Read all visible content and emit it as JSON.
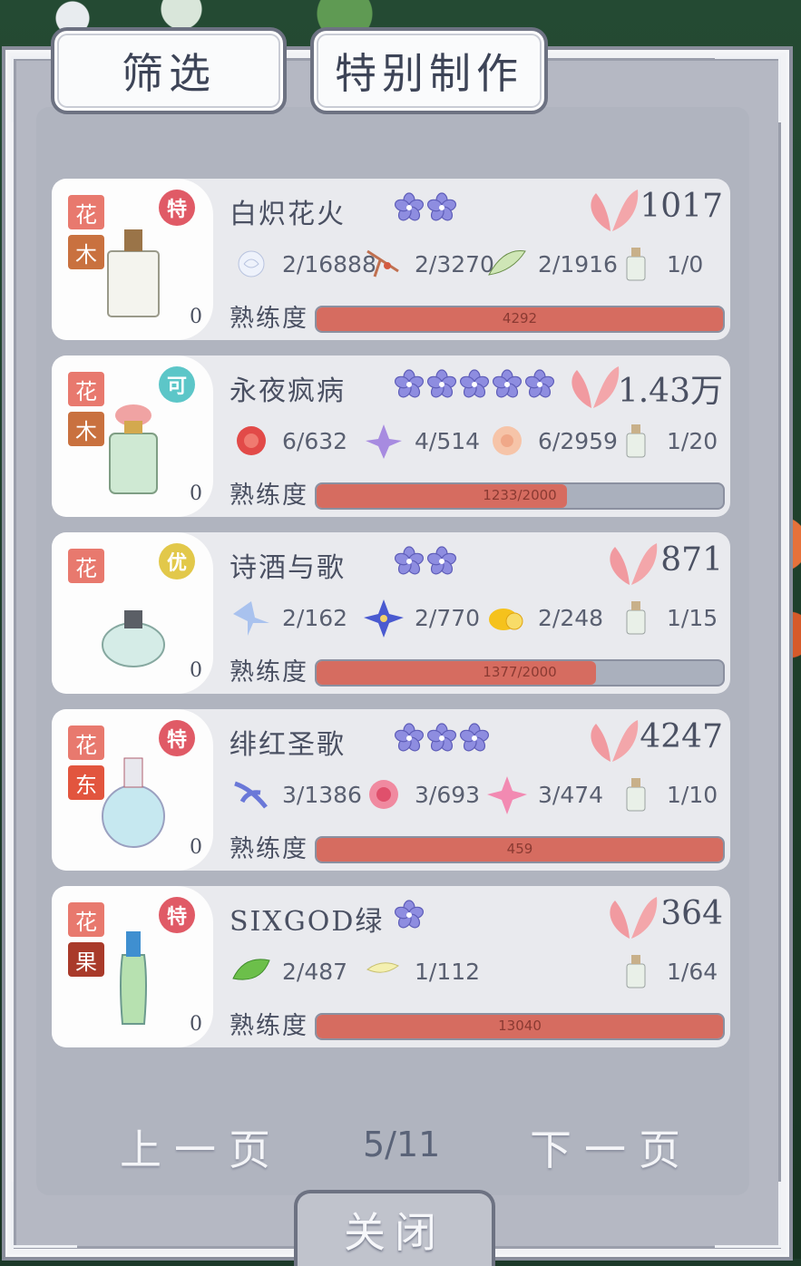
{
  "tabs": {
    "filter": "筛选",
    "special": "特别制作"
  },
  "proficiency_label": "熟练度",
  "colors": {
    "accent": "#d66c60",
    "tag_wood": "#c9713f",
    "tag_east": "#e2553e",
    "tag_fruit": "#a93a2a"
  },
  "recipes": [
    {
      "name": "白炽花火",
      "tag1": "花",
      "tag2": "木",
      "badge": "特",
      "badge_color": "#e05a66",
      "stars": 2,
      "score": "1017",
      "count": "0",
      "materials": [
        {
          "icon": "white-rose-icon",
          "value": "2/16888"
        },
        {
          "icon": "dried-twig-icon",
          "value": "2/3270"
        },
        {
          "icon": "green-leaf-icon",
          "value": "2/1916"
        },
        {
          "icon": "perfume-bottle-icon",
          "value": "1/0"
        }
      ],
      "bar_text": "4292",
      "progress": 1.0
    },
    {
      "name": "永夜疯病",
      "tag1": "花",
      "tag2": "木",
      "badge": "可",
      "badge_color": "#5cc6c8",
      "stars": 5,
      "score": "1.43万",
      "count": "0",
      "materials": [
        {
          "icon": "red-carnation-icon",
          "value": "6/632"
        },
        {
          "icon": "purple-lily-icon",
          "value": "4/514"
        },
        {
          "icon": "peach-rose-icon",
          "value": "6/2959"
        },
        {
          "icon": "perfume-bottle-icon",
          "value": "1/20"
        }
      ],
      "bar_text": "1233/2000",
      "progress": 0.6165
    },
    {
      "name": "诗酒与歌",
      "tag1": "花",
      "tag2": "",
      "badge": "优",
      "badge_color": "#e2c84a",
      "stars": 2,
      "score": "871",
      "count": "0",
      "materials": [
        {
          "icon": "blue-iris-icon",
          "value": "2/162"
        },
        {
          "icon": "blue-clematis-icon",
          "value": "2/770"
        },
        {
          "icon": "lemon-icon",
          "value": "2/248"
        },
        {
          "icon": "perfume-bottle-icon",
          "value": "1/15"
        }
      ],
      "bar_text": "1377/2000",
      "progress": 0.6885
    },
    {
      "name": "绯红圣歌",
      "tag1": "花",
      "tag2": "东",
      "badge": "特",
      "badge_color": "#e05a66",
      "stars": 3,
      "score": "4247",
      "count": "0",
      "materials": [
        {
          "icon": "blue-orchid-icon",
          "value": "3/1386"
        },
        {
          "icon": "pink-peony-icon",
          "value": "3/693"
        },
        {
          "icon": "pink-lily-icon",
          "value": "3/474"
        },
        {
          "icon": "perfume-bottle-icon",
          "value": "1/10"
        }
      ],
      "bar_text": "459",
      "progress": 1.0
    },
    {
      "name": "SIXGOD绿",
      "tag1": "花",
      "tag2": "果",
      "badge": "特",
      "badge_color": "#e05a66",
      "stars": 1,
      "score": "364",
      "count": "0",
      "materials": [
        {
          "icon": "mint-leaf-icon",
          "value": "2/487"
        },
        {
          "icon": "yellow-flower-icon",
          "value": "1/112"
        },
        {
          "icon": "perfume-bottle-icon",
          "value": "1/64"
        }
      ],
      "bar_text": "13040",
      "progress": 1.0
    }
  ],
  "pager": {
    "prev": "上一页",
    "indicator": "5/11",
    "next": "下一页"
  },
  "close_label": "关闭"
}
